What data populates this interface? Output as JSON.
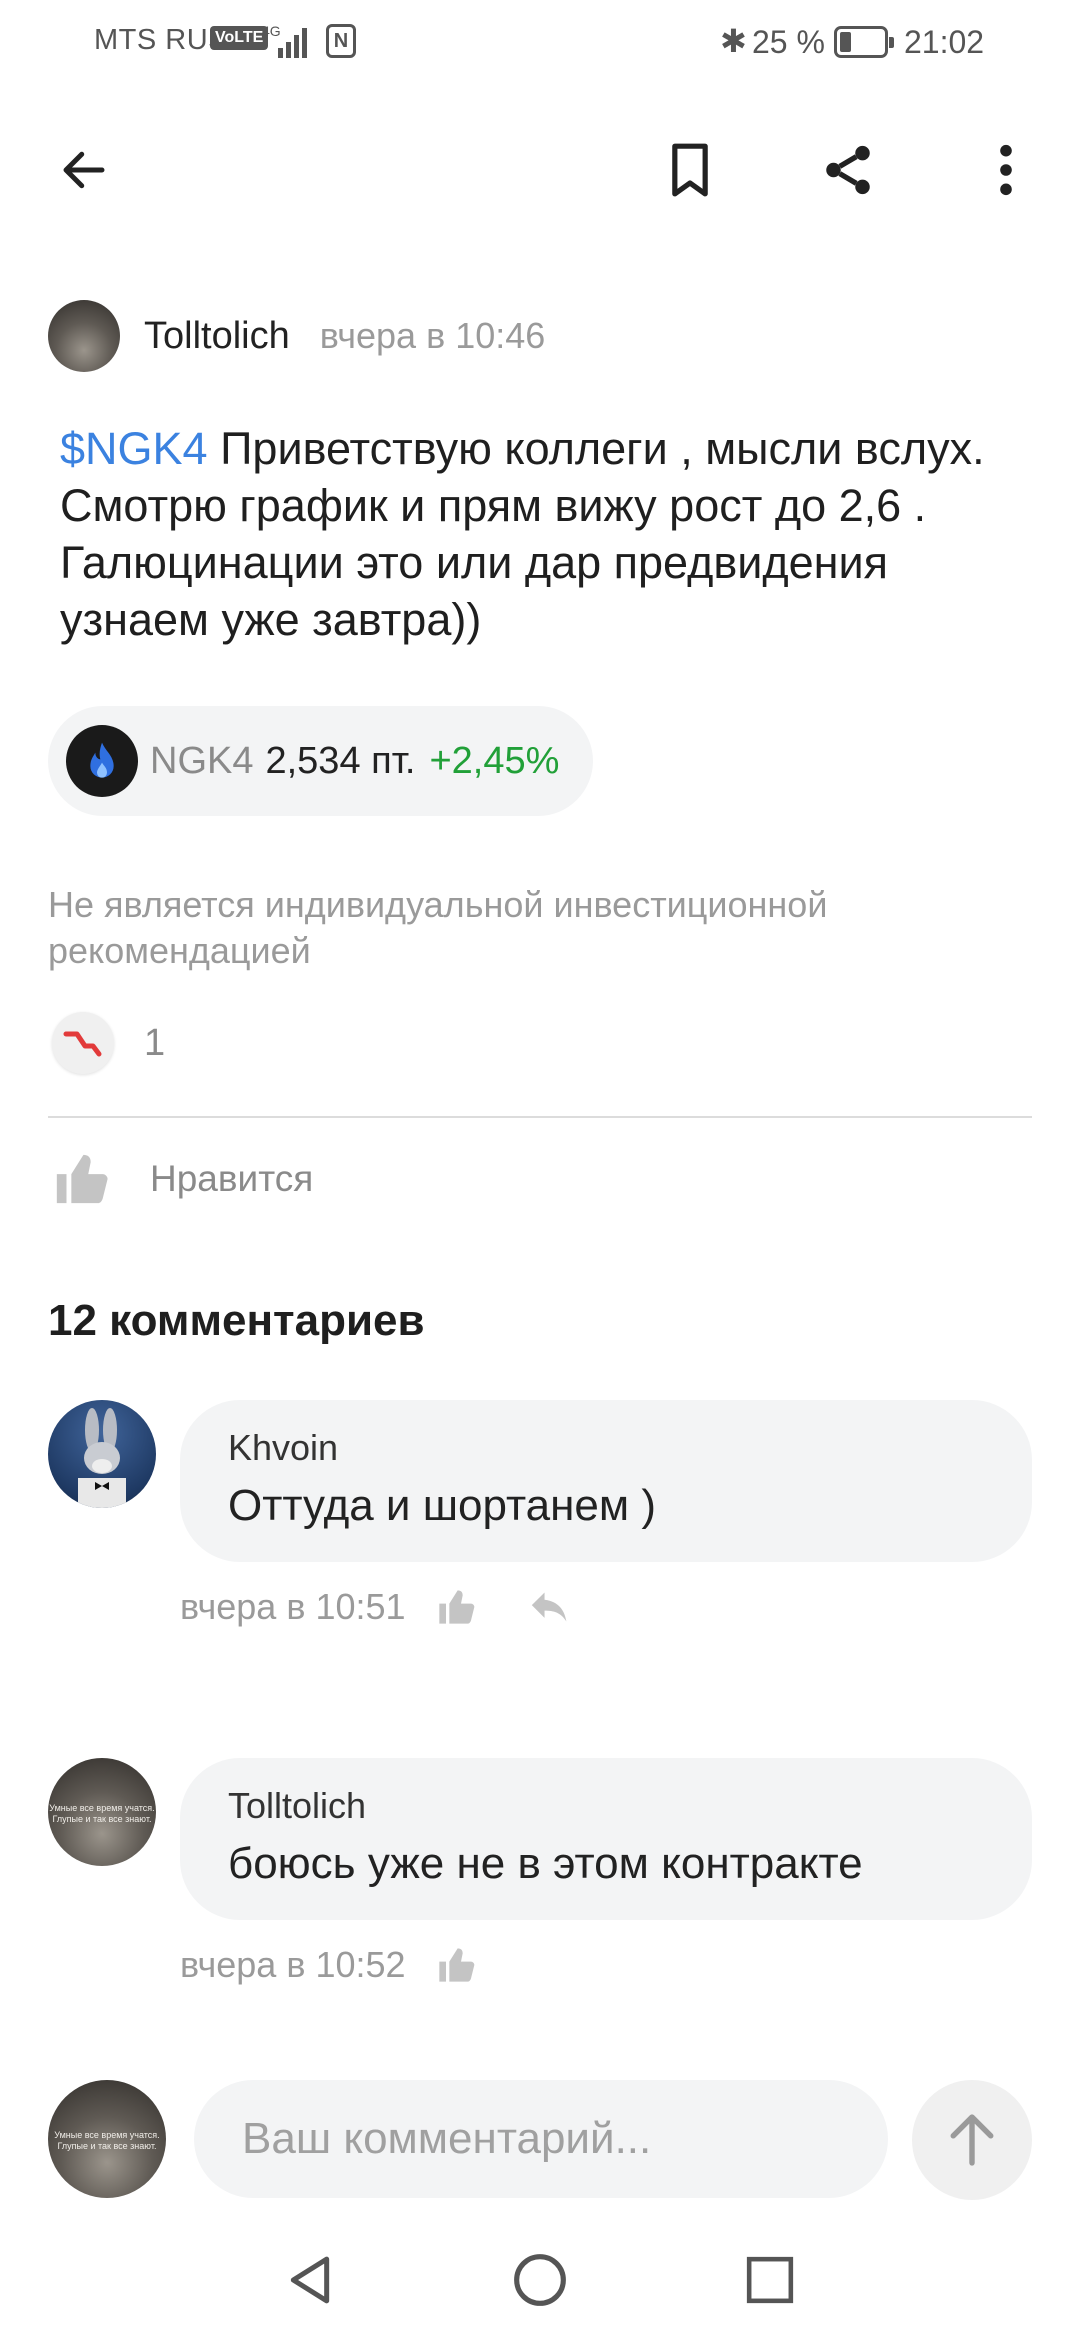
{
  "status_bar": {
    "carrier": "MTS RUS",
    "volte": "VoLTE",
    "network": "4G",
    "battery_percent": "25 %",
    "battery_level": 0.25,
    "time": "21:02"
  },
  "toolbar": {
    "back_icon": "arrow-left-icon",
    "bookmark_icon": "bookmark-icon",
    "share_icon": "share-icon",
    "more_icon": "more-vertical-icon"
  },
  "post": {
    "author": "Tolltolich",
    "time": "вчера в 10:46",
    "ticker_tag": "$NGK4",
    "text": " Приветствую коллеги , мысли вслух. Смотрю график и прям вижу рост до 2,6 . Галюцинации это или дар предвидения узнаем уже завтра))",
    "chip": {
      "symbol": "NGK4",
      "price": "2,534 пт.",
      "change": "+2,45%"
    },
    "disclaimer": "Не является индивидуальной инвестиционной рекомендацией",
    "reaction_count": "1",
    "like_label": "Нравится"
  },
  "comments": {
    "title": "12 комментариев",
    "items": [
      {
        "author": "Khvoin",
        "text": "Оттуда и шортанем )",
        "time": "вчера в 10:51"
      },
      {
        "author": "Tolltolich",
        "text": "боюсь уже не в этом контракте",
        "time": "вчера в 10:52"
      }
    ]
  },
  "avatar_caption": "Умные все время учатся. Глупые и так все знают.",
  "composer": {
    "placeholder": "Ваш комментарий..."
  },
  "colors": {
    "ticker_link": "#3b82e0",
    "positive_change": "#21a038",
    "muted_text": "#9a9a9a",
    "bubble_bg": "#f3f4f5"
  }
}
